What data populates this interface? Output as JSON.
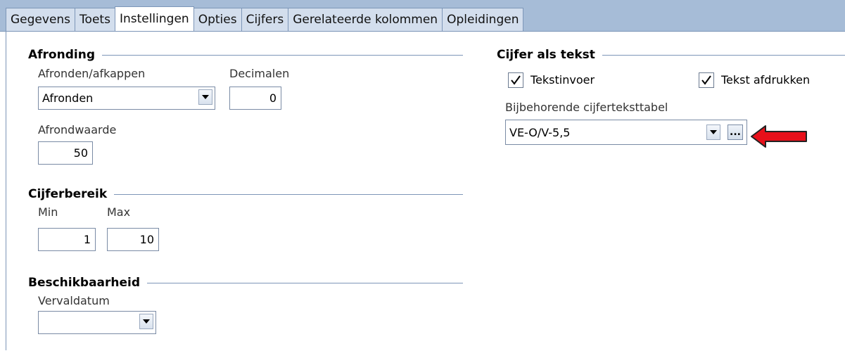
{
  "tabs": [
    {
      "label": "Gegevens",
      "active": false
    },
    {
      "label": "Toets",
      "active": false
    },
    {
      "label": "Instellingen",
      "active": true
    },
    {
      "label": "Opties",
      "active": false
    },
    {
      "label": "Cijfers",
      "active": false
    },
    {
      "label": "Gerelateerde kolommen",
      "active": false
    },
    {
      "label": "Opleidingen",
      "active": false
    }
  ],
  "afronding": {
    "title": "Afronding",
    "method_label": "Afronden/afkappen",
    "method_value": "Afronden",
    "decimals_label": "Decimalen",
    "decimals_value": "0",
    "round_value_label": "Afrondwaarde",
    "round_value": "50"
  },
  "cijferbereik": {
    "title": "Cijferbereik",
    "min_label": "Min",
    "min_value": "1",
    "max_label": "Max",
    "max_value": "10"
  },
  "beschikbaarheid": {
    "title": "Beschikbaarheid",
    "expiry_label": "Vervaldatum",
    "expiry_value": ""
  },
  "cijfer_als_tekst": {
    "title": "Cijfer als tekst",
    "text_input_label": "Tekstinvoer",
    "text_input_checked": true,
    "print_text_label": "Tekst afdrukken",
    "print_text_checked": true,
    "table_label": "Bijbehorende cijferteksttabel",
    "table_value": "VE-O/V-5,5",
    "browse_label": "..."
  },
  "colors": {
    "header_bg": "#a6bcd7",
    "tab_bg": "#d3deed",
    "border": "#7d96b8",
    "arrow": "#e8101a"
  }
}
